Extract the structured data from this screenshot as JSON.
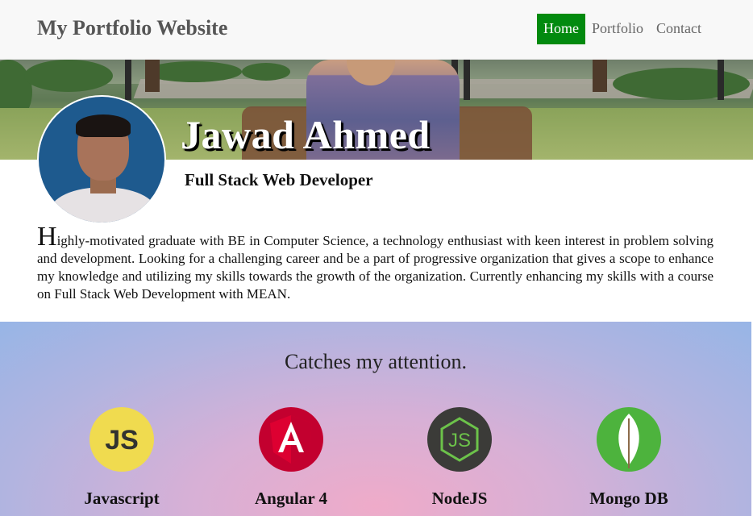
{
  "navbar": {
    "brand": "My Portfolio Website",
    "items": [
      {
        "label": "Home",
        "active": true
      },
      {
        "label": "Portfolio",
        "active": false
      },
      {
        "label": "Contact",
        "active": false
      }
    ],
    "active_color": "#028a0f"
  },
  "hero": {
    "name": "Jawad Ahmed",
    "role": "Full Stack Web Developer"
  },
  "about": {
    "first_letter": "H",
    "text": "ighly-motivated graduate with BE in Computer Science, a technology enthusiast with keen interest in problem solving and development. Looking for a challenging career and be a part of progressive organization that gives a scope to enhance my knowledge and utilizing my skills towards the growth of the organization. Currently enhancing my skills with a course on Full Stack Web Development with MEAN."
  },
  "skills": {
    "title": "Catches my attention.",
    "items": [
      {
        "label": "Javascript",
        "icon": "javascript-icon",
        "color": "#f0db4f"
      },
      {
        "label": "Angular 4",
        "icon": "angular-icon",
        "color": "#c3002f"
      },
      {
        "label": "NodeJS",
        "icon": "nodejs-icon",
        "color": "#3c873a"
      },
      {
        "label": "Mongo DB",
        "icon": "mongodb-icon",
        "color": "#4db33d"
      }
    ]
  }
}
